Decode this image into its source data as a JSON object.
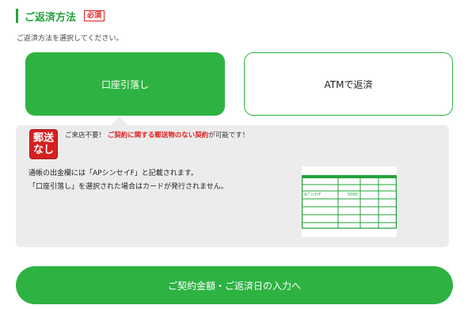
{
  "section": {
    "title": "ご返済方法",
    "required_badge": "必須",
    "subtitle": "ご返済方法を選択してください。"
  },
  "options": [
    {
      "label": "口座引落し",
      "selected": true
    },
    {
      "label": "ATMで返済",
      "selected": false
    }
  ],
  "info": {
    "stamp_line1": "郵送",
    "stamp_line2": "なし",
    "notice_prefix": "ご来店不要！",
    "notice_strong": "ご契約に関する郵送物のない契約",
    "notice_suffix": "が可能です！",
    "description_line1": "通帳の出金欄には「APシンセイF」と記載されます。",
    "description_line2": "「口座引落し」を選択された場合はカードが発行されません。",
    "passbook_entry_name": "AﾌﾟｼﾝｾｲF",
    "passbook_entry_amount": "5000"
  },
  "cta": {
    "label": "ご契約金額・ご返済日の入力へ"
  },
  "colors": {
    "brand_green": "#2eb342",
    "required_red": "#e02020",
    "panel_gray": "#ececec"
  }
}
